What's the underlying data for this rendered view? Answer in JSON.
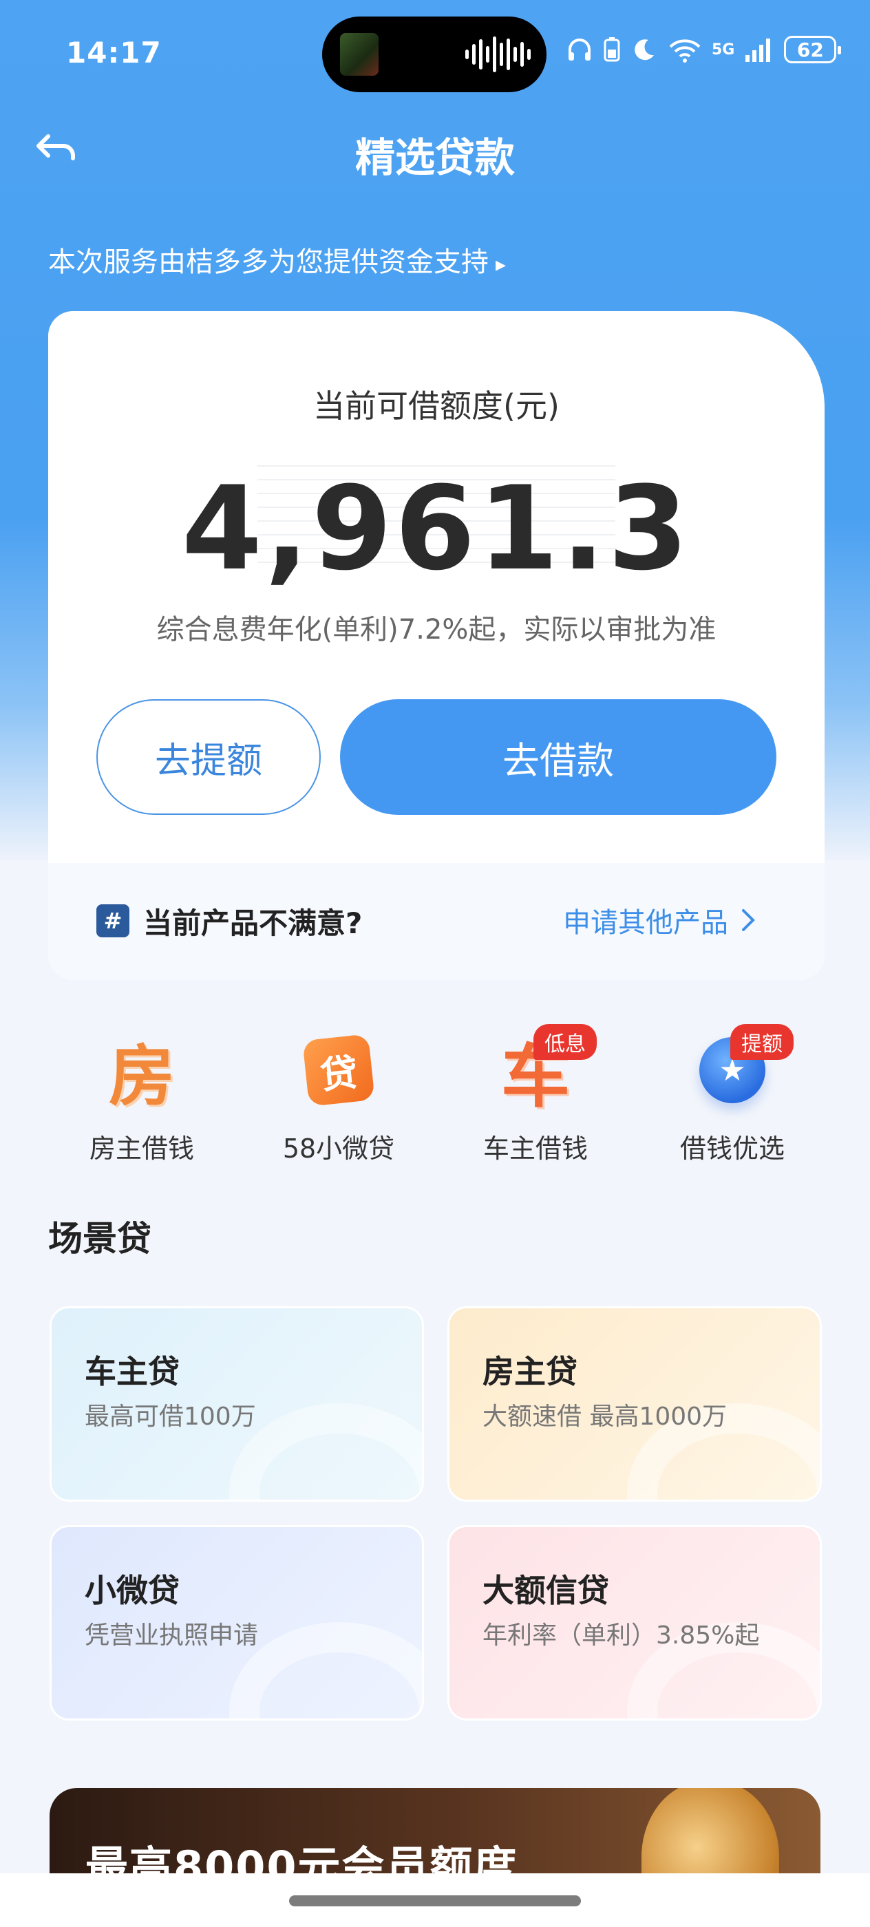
{
  "status_bar": {
    "time": "14:17",
    "battery": "62",
    "network": "5G"
  },
  "header": {
    "title": "精选贷款",
    "back_icon": "back-arrow-icon"
  },
  "provider_note": "本次服务由桔多多为您提供资金支持",
  "credit_card": {
    "label": "当前可借额度(元)",
    "amount": "4,961.3",
    "rate_note": "综合息费年化(单利)7.2%起，实际以审批为准",
    "raise_button": "去提额",
    "borrow_button": "去借款",
    "unsatisfied_text": "当前产品不满意?",
    "other_products_link": "申请其他产品"
  },
  "quick_entries": [
    {
      "label": "房主借钱",
      "icon": "house-char-icon",
      "glyph": "房",
      "tag": ""
    },
    {
      "label": "58小微贷",
      "icon": "loan-char-icon",
      "glyph": "贷",
      "tag": ""
    },
    {
      "label": "车主借钱",
      "icon": "car-char-icon",
      "glyph": "车",
      "tag": "低息"
    },
    {
      "label": "借钱优选",
      "icon": "star-globe-icon",
      "glyph": "★",
      "tag": "提额"
    }
  ],
  "scene_loans": {
    "title": "场景贷",
    "items": [
      {
        "title": "车主贷",
        "subtitle": "最高可借100万"
      },
      {
        "title": "房主贷",
        "subtitle": "大额速借 最高1000万"
      },
      {
        "title": "小微贷",
        "subtitle": "凭营业执照申请"
      },
      {
        "title": "大额信贷",
        "subtitle": "年利率（单利）3.85%起"
      }
    ]
  },
  "banner": {
    "text": "最高8000元会员额度"
  },
  "colors": {
    "primary": "#4598f1",
    "tag_red": "#e8362f",
    "link_blue": "#3c8ee8"
  }
}
